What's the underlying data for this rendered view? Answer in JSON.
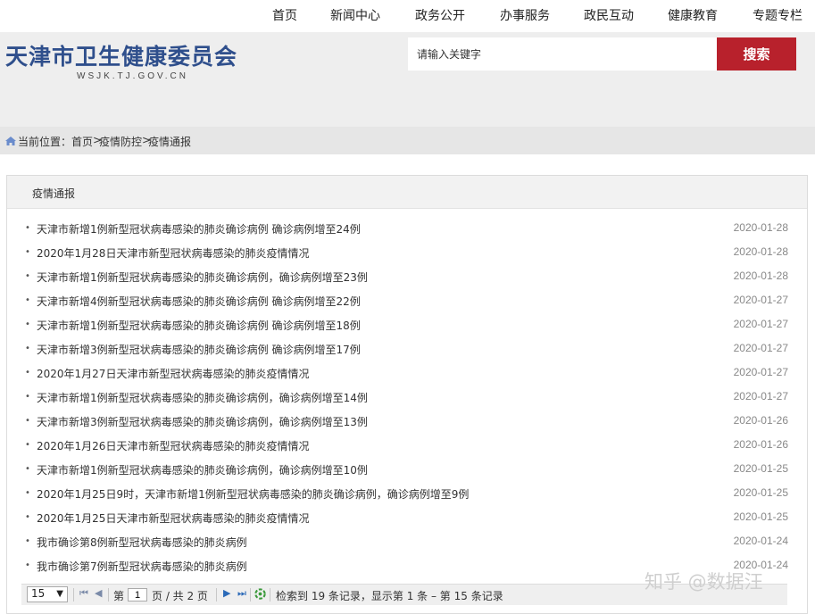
{
  "nav": {
    "items": [
      "首页",
      "新闻中心",
      "政务公开",
      "办事服务",
      "政民互动",
      "健康教育",
      "专题专栏"
    ]
  },
  "header": {
    "site_title": "天津市卫生健康委员会",
    "site_domain": "WSJK.TJ.GOV.CN",
    "search_placeholder": "请输入关键字",
    "search_button": "搜索",
    "accent_color": "#b8212c",
    "title_color": "#2f4f8c"
  },
  "breadcrumb": {
    "icon": "home-icon",
    "prefix": "当前位置：",
    "items": [
      "首页",
      "疫情防控",
      "疫情通报"
    ],
    "separator": ">"
  },
  "panel": {
    "title": "疫情通报",
    "articles": [
      {
        "title": "天津市新增1例新型冠状病毒感染的肺炎确诊病例 确诊病例增至24例",
        "date": "2020-01-28"
      },
      {
        "title": "2020年1月28日天津市新型冠状病毒感染的肺炎疫情情况",
        "date": "2020-01-28"
      },
      {
        "title": "天津市新增1例新型冠状病毒感染的肺炎确诊病例，确诊病例增至23例",
        "date": "2020-01-28"
      },
      {
        "title": "天津市新增4例新型冠状病毒感染的肺炎确诊病例 确诊病例增至22例",
        "date": "2020-01-27"
      },
      {
        "title": "天津市新增1例新型冠状病毒感染的肺炎确诊病例 确诊病例增至18例",
        "date": "2020-01-27"
      },
      {
        "title": "天津市新增3例新型冠状病毒感染的肺炎确诊病例 确诊病例增至17例",
        "date": "2020-01-27"
      },
      {
        "title": "2020年1月27日天津市新型冠状病毒感染的肺炎疫情情况",
        "date": "2020-01-27"
      },
      {
        "title": "天津市新增1例新型冠状病毒感染的肺炎确诊病例，确诊病例增至14例",
        "date": "2020-01-27"
      },
      {
        "title": "天津市新增3例新型冠状病毒感染的肺炎确诊病例，确诊病例增至13例",
        "date": "2020-01-26"
      },
      {
        "title": "2020年1月26日天津市新型冠状病毒感染的肺炎疫情情况",
        "date": "2020-01-26"
      },
      {
        "title": "天津市新增1例新型冠状病毒感染的肺炎确诊病例，确诊病例增至10例",
        "date": "2020-01-25"
      },
      {
        "title": "2020年1月25日9时，天津市新增1例新型冠状病毒感染的肺炎确诊病例，确诊病例增至9例",
        "date": "2020-01-25"
      },
      {
        "title": "2020年1月25日天津市新型冠状病毒感染的肺炎疫情情况",
        "date": "2020-01-25"
      },
      {
        "title": "我市确诊第8例新型冠状病毒感染的肺炎病例",
        "date": "2020-01-24"
      },
      {
        "title": "我市确诊第7例新型冠状病毒感染的肺炎病例",
        "date": "2020-01-24"
      }
    ]
  },
  "pager": {
    "page_size": "15",
    "page_label_prefix": "第",
    "current_page": "1",
    "page_label_suffix": "页 / 共 2 页",
    "record_info": "检索到 19 条记录，显示第 1 条 – 第 15 条记录"
  },
  "watermark": "知乎 @数据汪"
}
